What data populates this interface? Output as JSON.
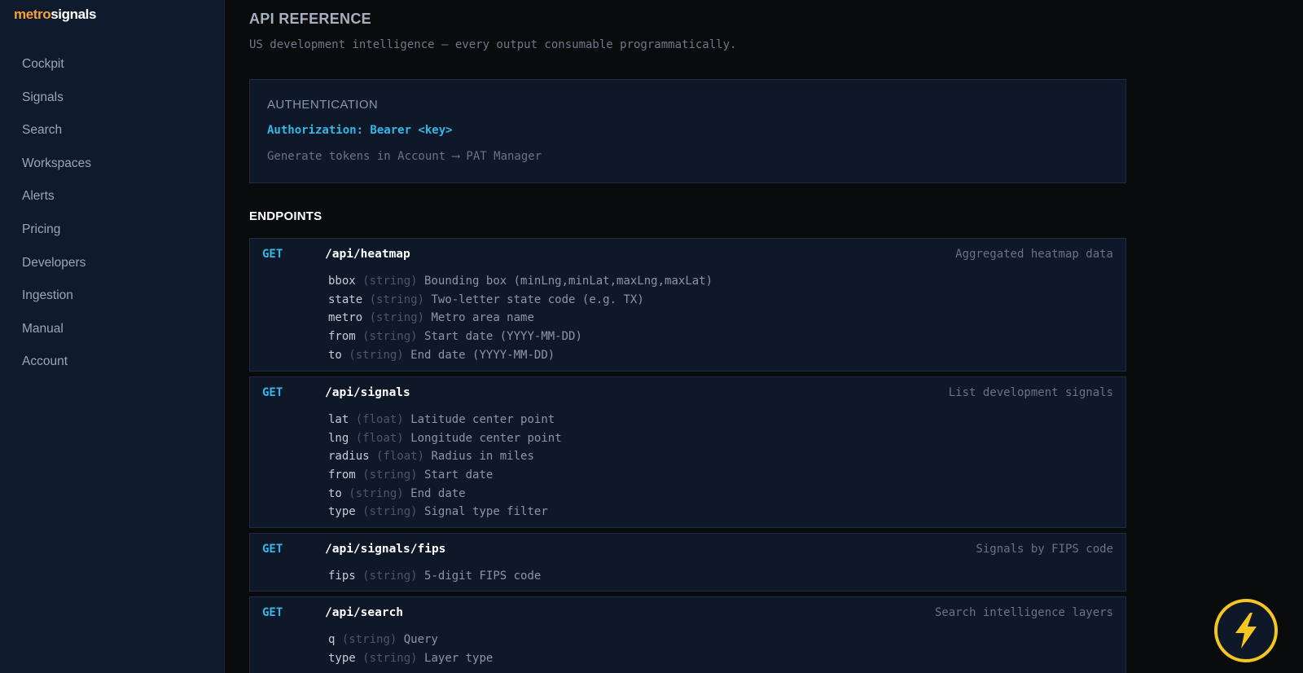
{
  "brand": {
    "part1": "metro",
    "part2": "signals"
  },
  "nav": [
    "Cockpit",
    "Signals",
    "Search",
    "Workspaces",
    "Alerts",
    "Pricing",
    "Developers",
    "Ingestion",
    "Manual",
    "Account"
  ],
  "page": {
    "title": "API REFERENCE",
    "subtitle": "US development intelligence — every output consumable programmatically."
  },
  "auth": {
    "heading": "AUTHENTICATION",
    "header": "Authorization: Bearer <key>",
    "note": "Generate tokens in Account ⟶ PAT Manager"
  },
  "endpoints_heading": "ENDPOINTS",
  "endpoints": [
    {
      "method": "GET",
      "path": "/api/heatmap",
      "description": "Aggregated heatmap data",
      "params": [
        {
          "name": "bbox",
          "type": "(string)",
          "desc": "Bounding box (minLng,minLat,maxLng,maxLat)"
        },
        {
          "name": "state",
          "type": "(string)",
          "desc": "Two-letter state code (e.g. TX)"
        },
        {
          "name": "metro",
          "type": "(string)",
          "desc": "Metro area name"
        },
        {
          "name": "from",
          "type": "(string)",
          "desc": "Start date (YYYY-MM-DD)"
        },
        {
          "name": "to",
          "type": "(string)",
          "desc": "End date (YYYY-MM-DD)"
        }
      ]
    },
    {
      "method": "GET",
      "path": "/api/signals",
      "description": "List development signals",
      "params": [
        {
          "name": "lat",
          "type": "(float)",
          "desc": "Latitude center point"
        },
        {
          "name": "lng",
          "type": "(float)",
          "desc": "Longitude center point"
        },
        {
          "name": "radius",
          "type": "(float)",
          "desc": "Radius in miles"
        },
        {
          "name": "from",
          "type": "(string)",
          "desc": "Start date"
        },
        {
          "name": "to",
          "type": "(string)",
          "desc": "End date"
        },
        {
          "name": "type",
          "type": "(string)",
          "desc": "Signal type filter"
        }
      ]
    },
    {
      "method": "GET",
      "path": "/api/signals/fips",
      "description": "Signals by FIPS code",
      "params": [
        {
          "name": "fips",
          "type": "(string)",
          "desc": "5-digit FIPS code"
        }
      ]
    },
    {
      "method": "GET",
      "path": "/api/search",
      "description": "Search intelligence layers",
      "params": [
        {
          "name": "q",
          "type": "(string)",
          "desc": "Query"
        },
        {
          "name": "type",
          "type": "(string)",
          "desc": "Layer type"
        }
      ]
    }
  ],
  "fab": {
    "icon": "lightning-icon",
    "color": "#f4c61f"
  }
}
